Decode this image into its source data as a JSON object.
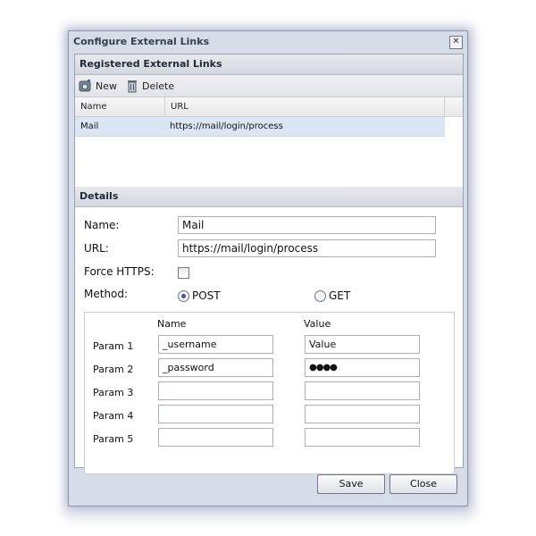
{
  "dialog": {
    "title": "Configure External Links",
    "close_glyph": "✕"
  },
  "registered": {
    "header": "Registered External Links",
    "toolbar": {
      "new_label": "New",
      "delete_label": "Delete"
    },
    "columns": [
      "Name",
      "URL"
    ],
    "rows": [
      {
        "name": "Mail",
        "url": "https://mail/login/process"
      }
    ]
  },
  "details": {
    "header": "Details",
    "name_label": "Name:",
    "name_value": "Mail",
    "url_label": "URL:",
    "url_value": "https://mail/login/process",
    "force_https_label": "Force HTTPS:",
    "force_https_checked": false,
    "method_label": "Method:",
    "method_options": [
      "POST",
      "GET"
    ],
    "method_selected": "POST",
    "params": {
      "name_header": "Name",
      "value_header": "Value",
      "rows": [
        {
          "label": "Param 1",
          "name": "_username",
          "value": "Value"
        },
        {
          "label": "Param 2",
          "name": "_password",
          "value": "●●●●"
        },
        {
          "label": "Param 3",
          "name": "",
          "value": ""
        },
        {
          "label": "Param 4",
          "name": "",
          "value": ""
        },
        {
          "label": "Param 5",
          "name": "",
          "value": ""
        }
      ]
    }
  },
  "buttons": {
    "save": "Save",
    "close": "Close"
  },
  "colors": {
    "selected_row": "#dbe6f5",
    "dialog_bg": "#d7dde8",
    "radio_dot": "#3b5998"
  }
}
